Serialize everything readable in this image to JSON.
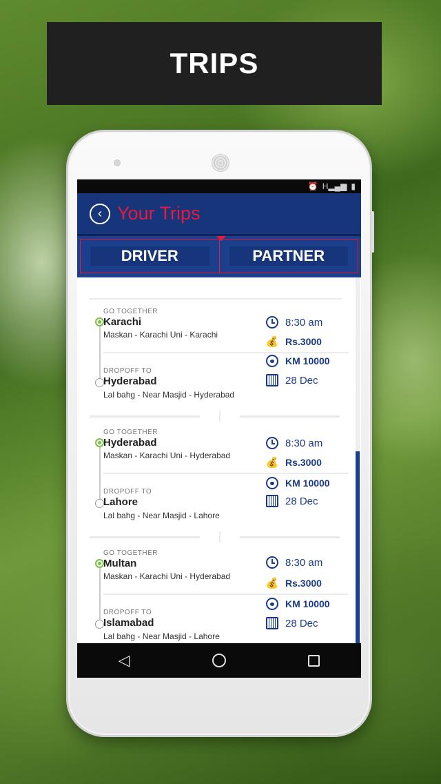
{
  "banner": {
    "title": "TRIPS"
  },
  "statusbar": {
    "icons": [
      "alarm-icon",
      "signal-icon",
      "battery-icon"
    ],
    "signal_text": "H"
  },
  "appbar": {
    "title": "Your Trips"
  },
  "tabs": [
    {
      "label": "DRIVER"
    },
    {
      "label": "PARTNER"
    }
  ],
  "colors": {
    "appbar_bg": "#17357a",
    "accent_red": "#e8193c",
    "text_blue": "#1a3a8a",
    "start_dot": "#7bc043"
  },
  "trips": [
    {
      "pickup_label": "GO TOGETHER",
      "pickup_city": "Karachi",
      "pickup_route": "Maskan - Karachi Uni - Karachi",
      "dropoff_label": "DROPOFF  TO",
      "dropoff_city": "Hyderabad",
      "dropoff_route": "Lal bahg - Near Masjid - Hyderabad",
      "time": "8:30 am",
      "price": "Rs.3000",
      "distance": "KM 10000",
      "date": "28 Dec"
    },
    {
      "pickup_label": "GO TOGETHER",
      "pickup_city": "Hyderabad",
      "pickup_route": "Maskan - Karachi Uni - Hyderabad",
      "dropoff_label": "DROPOFF  TO",
      "dropoff_city": "Lahore",
      "dropoff_route": "Lal bahg - Near Masjid - Lahore",
      "time": "8:30 am",
      "price": "Rs.3000",
      "distance": "KM 10000",
      "date": "28 Dec"
    },
    {
      "pickup_label": "GO TOGETHER",
      "pickup_city": "Multan",
      "pickup_route": "Maskan - Karachi Uni - Hyderabad",
      "dropoff_label": "DROPOFF  TO",
      "dropoff_city": "Islamabad",
      "dropoff_route": "Lal bahg - Near Masjid - Lahore",
      "time": "8:30 am",
      "price": "Rs.3000",
      "distance": "KM 10000",
      "date": "28 Dec"
    }
  ],
  "navbar": {
    "icons": [
      "back-triangle-icon",
      "home-circle-icon",
      "recents-square-icon"
    ]
  }
}
